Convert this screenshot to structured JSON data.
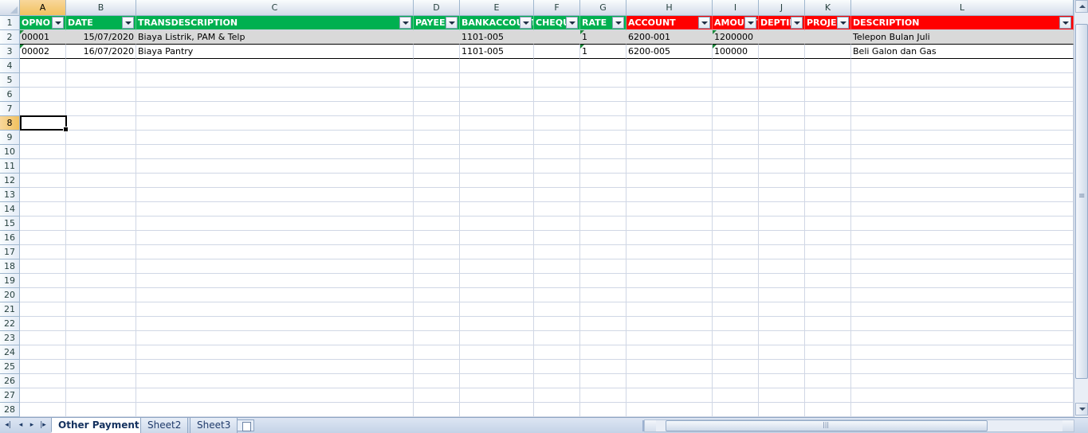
{
  "columns": [
    "A",
    "B",
    "C",
    "D",
    "E",
    "F",
    "G",
    "H",
    "I",
    "J",
    "K",
    "L"
  ],
  "rows": [
    "1",
    "2",
    "3",
    "4",
    "5",
    "6",
    "7",
    "8",
    "9",
    "10",
    "11",
    "12",
    "13",
    "14",
    "15",
    "16",
    "17",
    "18",
    "19",
    "20",
    "21",
    "22",
    "23",
    "24",
    "25",
    "26",
    "27",
    "28"
  ],
  "header_row": {
    "A": "OPNO",
    "B": "DATE",
    "C": "TRANSDESCRIPTION",
    "D": "PAYEE",
    "E": "BANKACCOUNT",
    "F": "CHEQUE",
    "G": "RATE",
    "H": "ACCOUNT",
    "I": "AMOUNT",
    "J": "DEPTID",
    "K": "PROJECT",
    "L": "DESCRIPTION"
  },
  "data_rows": [
    {
      "A": "00001",
      "B": "15/07/2020",
      "C": "Biaya Listrik, PAM & Telp",
      "D": "",
      "E": "1101-005",
      "F": "",
      "G": "1",
      "H": "6200-001",
      "I": "1200000",
      "J": "",
      "K": "",
      "L": "Telepon Bulan Juli"
    },
    {
      "A": "00002",
      "B": "16/07/2020",
      "C": "Biaya Pantry",
      "D": "",
      "E": "1101-005",
      "F": "",
      "G": "1",
      "H": "6200-005",
      "I": "100000",
      "J": "",
      "K": "",
      "L": "Beli Galon dan Gas"
    }
  ],
  "active_cell": "A8",
  "sheet_tabs": [
    "Other Payment",
    "Sheet2",
    "Sheet3"
  ],
  "active_tab": "Other Payment",
  "colors": {
    "header_green": "#00b050",
    "header_red": "#ff0000",
    "selected_header": "#f1c15f",
    "gridline": "#d0d7e5"
  },
  "icons": {
    "filter": "filter-dropdown-icon",
    "new_sheet": "insert-sheet-icon",
    "nav_first": "first-sheet-icon",
    "nav_prev": "previous-sheet-icon",
    "nav_next": "next-sheet-icon",
    "nav_last": "last-sheet-icon"
  }
}
